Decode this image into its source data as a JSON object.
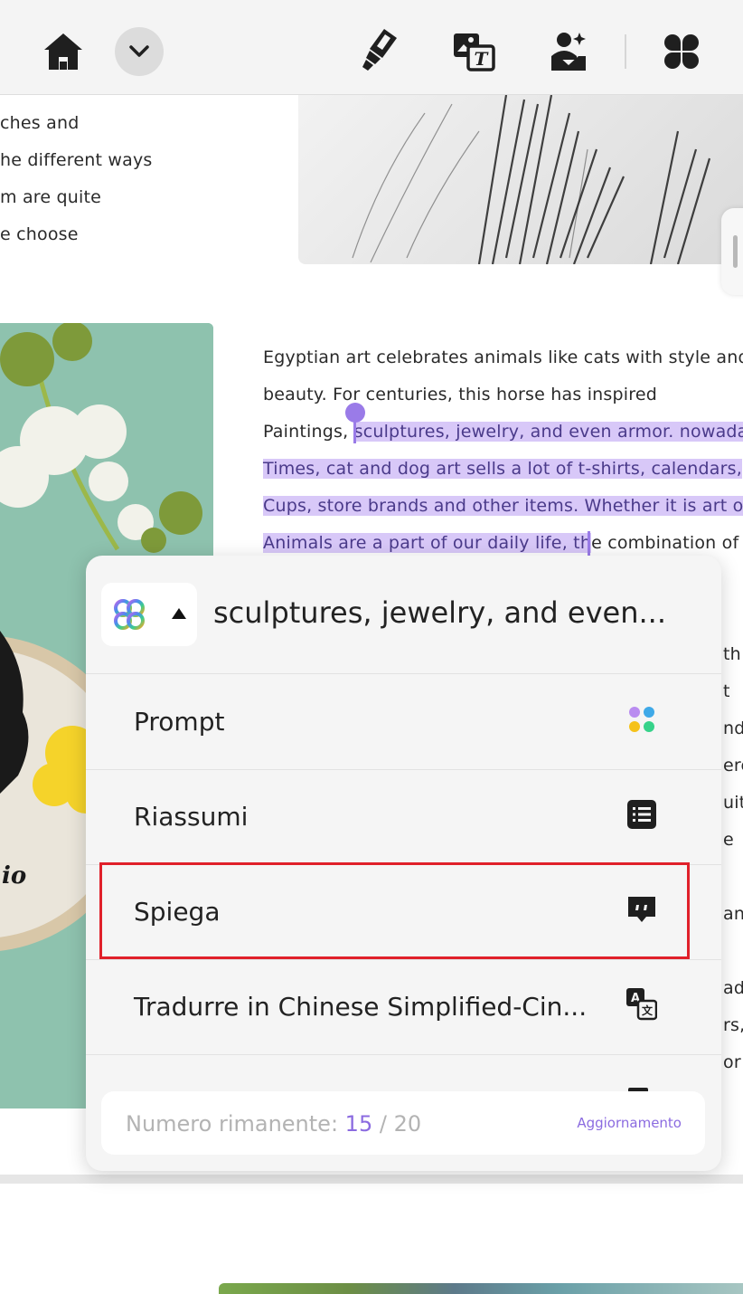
{
  "toolbar": {
    "icons": [
      "home-icon",
      "chevron-down-icon",
      "highlighter-icon",
      "image-translate-icon",
      "ai-image-icon",
      "apps-grid-icon"
    ]
  },
  "document": {
    "top_lines": [
      "ches and",
      "he different ways",
      "m are quite",
      "e choose"
    ],
    "paragraph": {
      "line1": "Egyptian art celebrates animals like cats with style and",
      "line2": "beauty. For centuries, this horse has inspired",
      "line3_plain": "Paintings,",
      "line3_hl": "sculptures, jewelry, and even armor. nowada",
      "line4_hl": "Times, cat and dog art sells a lot of t-shirts, calendars,",
      "line5_hl": "Cups, store brands and other items. Whether it is art or",
      "line6_hl": "Animals are a part of our daily life, th",
      "line6_plain": "e combination of"
    },
    "right_fragments": [
      "th",
      "t",
      "nd",
      "ere",
      "uit",
      "e",
      "and",
      "ada",
      "rs,",
      "or"
    ],
    "embroidery_text": "io"
  },
  "popup": {
    "selected_text": "sculptures, jewelry, and even...",
    "menu_items": [
      {
        "label": "Prompt",
        "icon": "prompt-dots-icon"
      },
      {
        "label": "Riassumi",
        "icon": "summary-list-icon"
      },
      {
        "label": "Spiega",
        "icon": "explain-quote-icon"
      },
      {
        "label": "Tradurre in Chinese Simplified-Cin...",
        "icon": "translate-icon"
      }
    ],
    "remaining_label": "Numero rimanente:",
    "remaining_used": "15",
    "remaining_sep": "/",
    "remaining_total": "20",
    "upgrade_label": "Aggiornamento"
  },
  "colors": {
    "accent": "#8b6be0",
    "highlight": "#d8c8f8",
    "selection_box": "#e0202a"
  }
}
